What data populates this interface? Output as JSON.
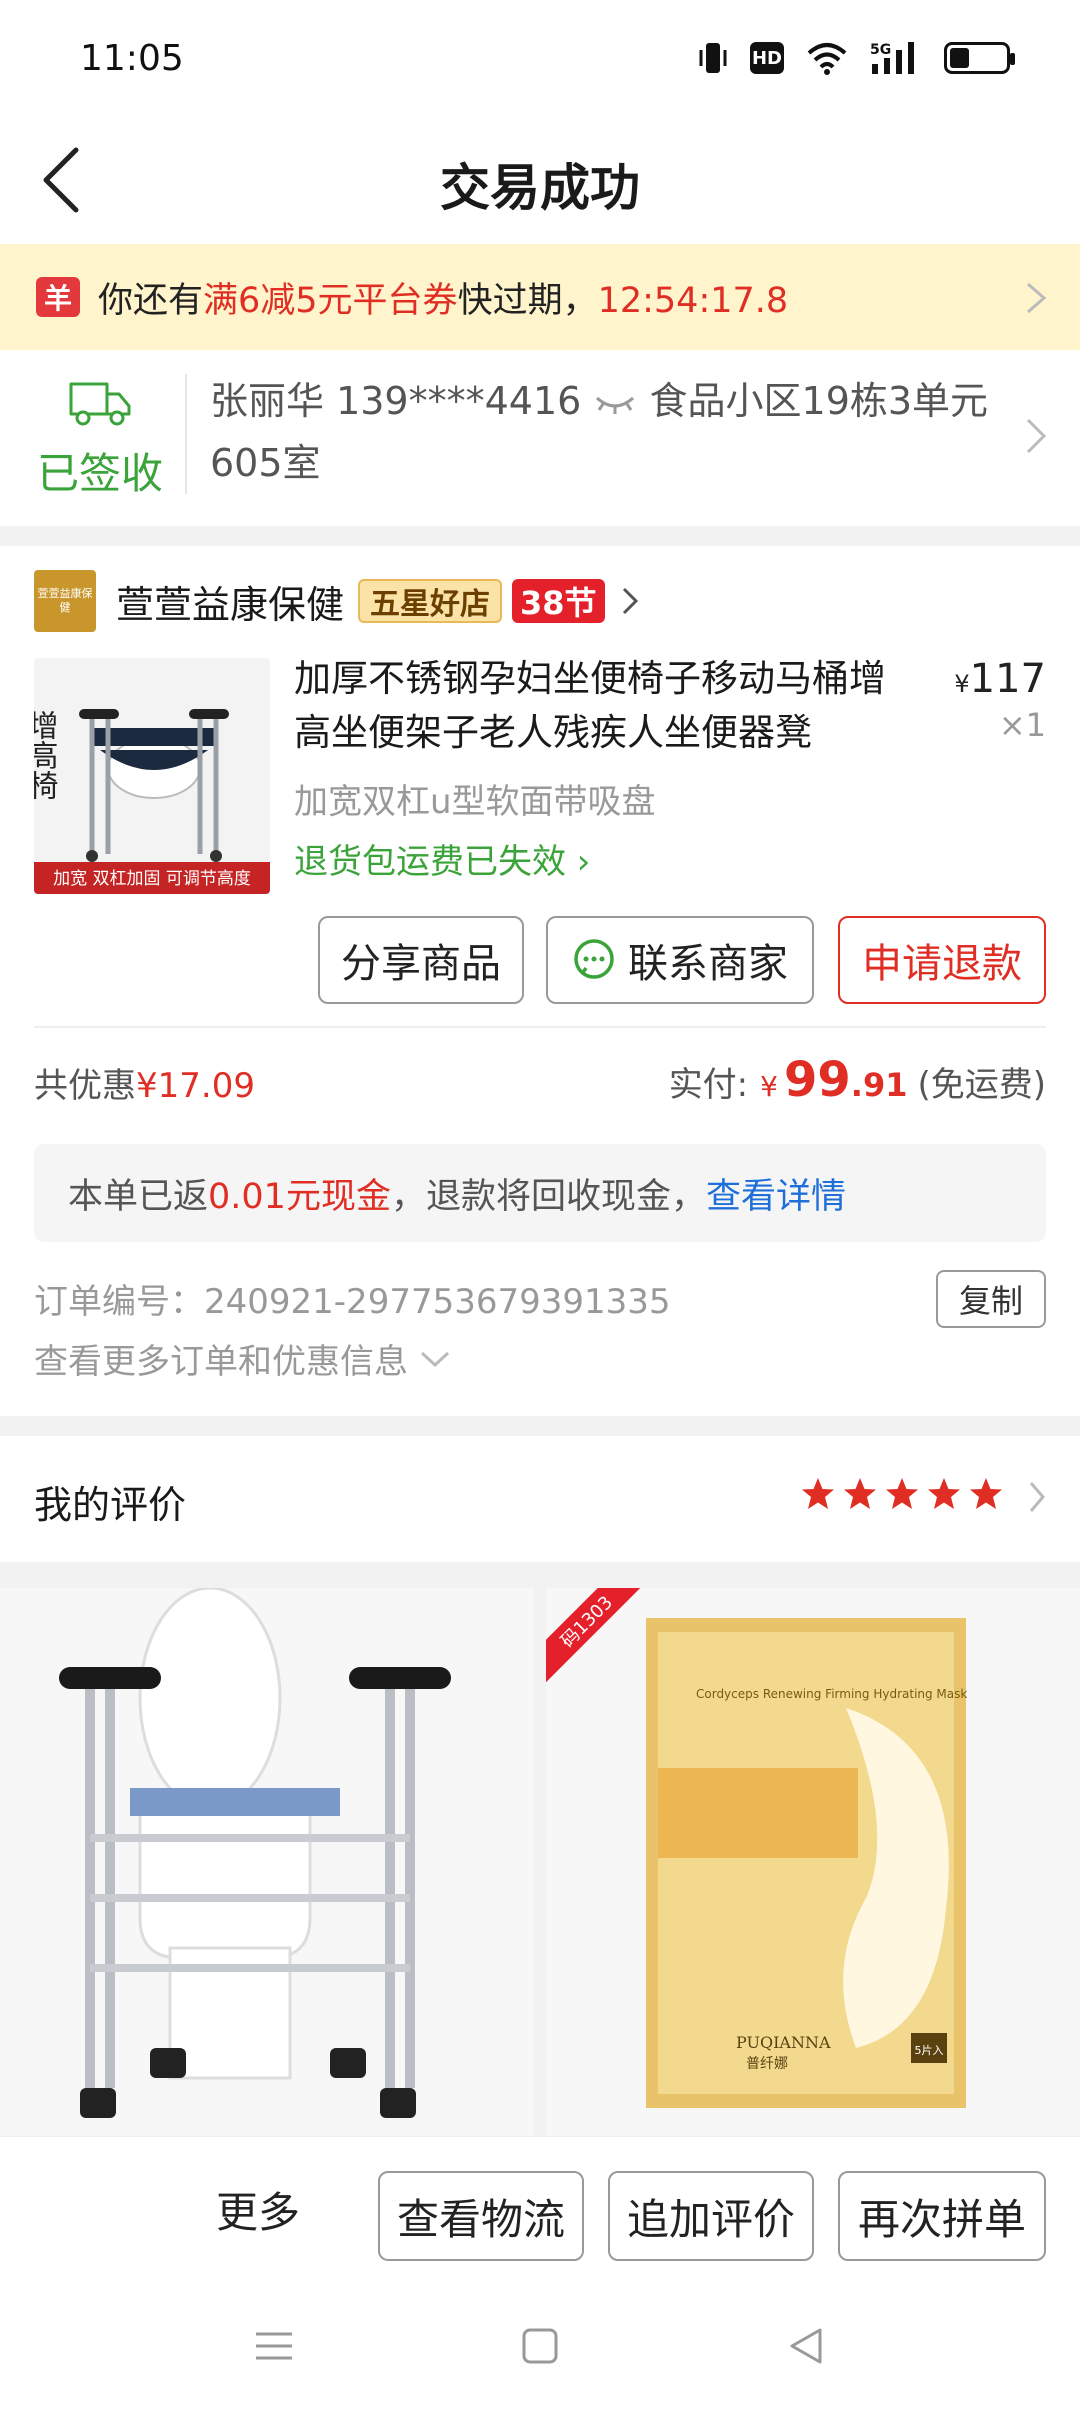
{
  "status_bar": {
    "time": "11:05",
    "hd_label": "HD",
    "network_label": "5G",
    "battery_level": 0.35
  },
  "header": {
    "title": "交易成功"
  },
  "coupon_banner": {
    "icon_label": "羊",
    "prefix": "你还有",
    "coupon": "满6减5元平台券",
    "suffix": "快过期，",
    "countdown": "12:54:17.8"
  },
  "shipping": {
    "status": "已签收",
    "recipient": "张丽华 139****4416",
    "address": "食品小区19栋3单元605室"
  },
  "shop": {
    "logo_text": "萱萱益康保健",
    "name": "萱萱益康保健",
    "badge": "五星好店",
    "festival_badge": "38节"
  },
  "product": {
    "title": "加厚不锈钢孕妇坐便椅子移动马桶增高坐便架子老人残疾人坐便器凳",
    "price_symbol": "¥",
    "price": "117",
    "quantity": "×1",
    "spec": "加宽双杠u型软面带吸盘",
    "return_shipping": "退货包运费已失效",
    "image_caption": "加宽  双杠加固  可调节高度",
    "image_overlay_text": "增高椅"
  },
  "actions": {
    "share": "分享商品",
    "contact": "联系商家",
    "refund": "申请退款"
  },
  "summary": {
    "discount_label": "共优惠",
    "discount_value": "¥17.09",
    "paid_label": "实付:",
    "paid_currency": "¥",
    "paid_integer": "99",
    "paid_decimal": ".91",
    "shipping_note": "(免运费)"
  },
  "cash_notice": {
    "prefix": "本单已返",
    "amount": "0.01元现金",
    "middle": "，退款将回收现金，",
    "link": "查看详情"
  },
  "order": {
    "number_label": "订单编号：",
    "number": "240921-297753679391335",
    "copy_label": "复制",
    "more_info": "查看更多订单和优惠信息"
  },
  "review": {
    "title": "我的评价",
    "rating": 5
  },
  "recommendations": {
    "left_alt": "坐便椅",
    "right_tag": "码1303",
    "right_brand": "PUQIANNA",
    "right_brand_cn": "普纤娜",
    "right_title_en": "Cordyceps Renewing Firming Hydrating Mask",
    "right_pack": "5片入"
  },
  "bottom_bar": {
    "more": "更多",
    "logistics": "查看物流",
    "add_review": "追加评价",
    "reorder": "再次拼单"
  },
  "colors": {
    "accent_red": "#e02e24",
    "success_green": "#3aa339",
    "link_blue": "#1e6fd9",
    "banner_bg": "#fff4cc"
  }
}
